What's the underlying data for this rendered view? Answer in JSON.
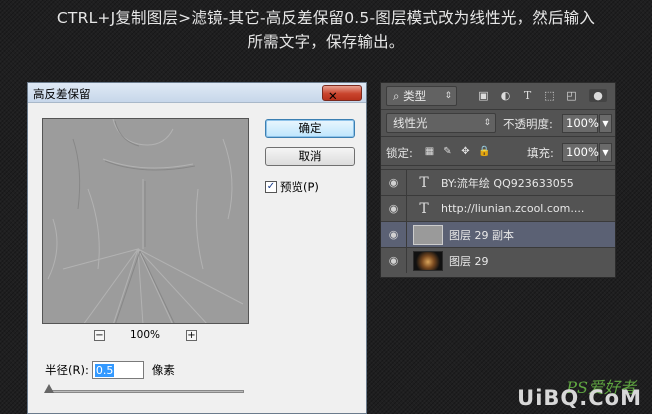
{
  "caption": {
    "line1": "CTRL+J复制图层>滤镜-其它-高反差保留0.5-图层模式改为线性光，然后输入",
    "line2": "所需文字，保存输出。"
  },
  "dialog": {
    "title": "高反差保留",
    "ok_label": "确定",
    "cancel_label": "取消",
    "preview_label": "预览(P)",
    "preview_checked": true,
    "zoom": "100%",
    "zoom_out": "−",
    "zoom_in": "+",
    "radius_label": "半径(R):",
    "radius_value": "0.5",
    "radius_unit": "像素"
  },
  "layers_panel": {
    "filter_kind": "类型",
    "blend_mode": "线性光",
    "opacity_label": "不透明度:",
    "opacity_value": "100%",
    "lock_label": "锁定:",
    "fill_label": "填充:",
    "fill_value": "100%",
    "layers": [
      {
        "type": "text",
        "name": "BY:流年绘  QQ923633055",
        "visible": true,
        "selected": false
      },
      {
        "type": "text",
        "name": "http://liunian.zcool.com....",
        "visible": true,
        "selected": false
      },
      {
        "type": "image",
        "name": "图层 29 副本",
        "visible": true,
        "selected": true
      },
      {
        "type": "image",
        "name": "图层 29",
        "visible": true,
        "selected": false
      }
    ]
  },
  "watermark": {
    "top": "PS爱好者",
    "bottom": "UiBQ.CoM"
  },
  "colors": {
    "background": "#1e1e1f",
    "panel": "#535353",
    "selected_layer": "#5b6174",
    "dialog": "#f0f0f0",
    "watermark_green": "#5fa641"
  }
}
